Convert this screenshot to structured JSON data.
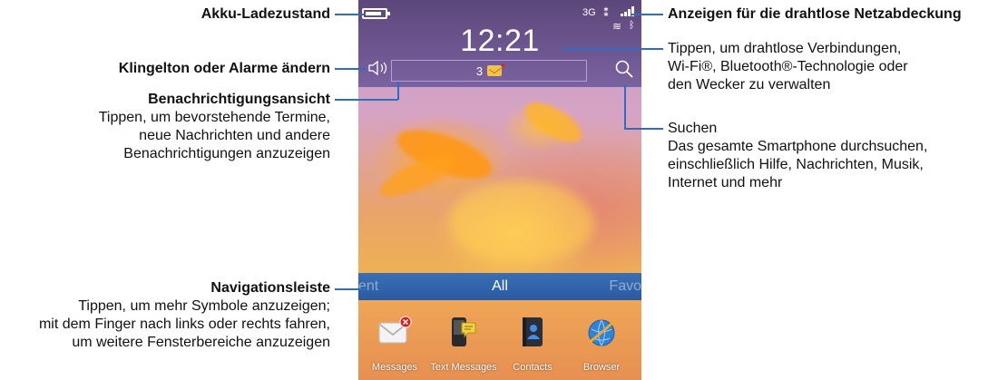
{
  "phone": {
    "clock": "12:21",
    "network": "3G",
    "notification_count": "3",
    "battery_level": 0.85,
    "nav": {
      "left": "ent",
      "center": "All",
      "right": "Favo"
    },
    "apps": [
      {
        "label": "Messages",
        "icon": "messages-envelope-icon"
      },
      {
        "label": "Text Messages",
        "icon": "text-messages-icon"
      },
      {
        "label": "Contacts",
        "icon": "contacts-book-icon"
      },
      {
        "label": "Browser",
        "icon": "browser-globe-icon"
      }
    ],
    "colors": {
      "status_bar": "#6b5590",
      "nav_bar": "#3265ab",
      "callout_line": "#2a6fc4"
    }
  },
  "annotations": {
    "battery": {
      "title": "Akku-Ladezustand"
    },
    "ringtone": {
      "title": "Klingelton oder Alarme ändern"
    },
    "notifications": {
      "title": "Benachrichtigungsansicht",
      "lines": [
        "Tippen, um bevorstehende Termine,",
        "neue Nachrichten und andere",
        "Benachrichtigungen anzuzeigen"
      ]
    },
    "navigation": {
      "title": "Navigationsleiste",
      "lines": [
        "Tippen, um mehr Symbole anzuzeigen;",
        "mit dem Finger nach links oder rechts fahren,",
        "um weitere Fensterbereiche anzuzeigen"
      ]
    },
    "coverage": {
      "title": "Anzeigen für die drahtlose Netzabdeckung"
    },
    "connections": {
      "lines": [
        "Tippen, um drahtlose Verbindungen,",
        "Wi-Fi®, Bluetooth®-Technologie oder",
        "den Wecker zu verwalten"
      ]
    },
    "search": {
      "title": "Suchen",
      "lines": [
        "Das gesamte Smartphone durchsuchen,",
        "einschließlich Hilfe, Nachrichten, Musik,",
        "Internet und mehr"
      ]
    }
  }
}
